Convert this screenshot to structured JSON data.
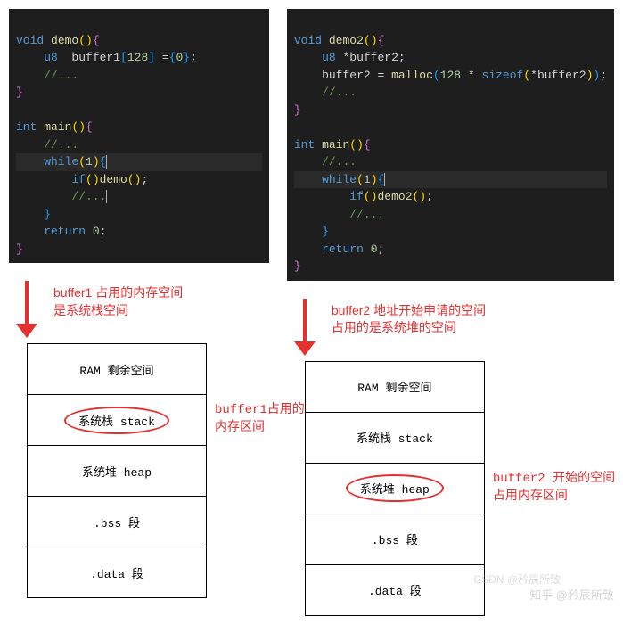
{
  "left": {
    "code": {
      "l1": {
        "kw": "void ",
        "fn": "demo",
        "rest": "(){"
      },
      "l2": {
        "type": "    u8",
        "var": "  buffer1",
        "rest": "[128] ={0};"
      },
      "l3": "    //...",
      "l4": "}",
      "l5": "",
      "l6": {
        "kw": "int ",
        "fn": "main",
        "rest": "(){"
      },
      "l7": "    //...",
      "l8": {
        "kw": "    while",
        "rest": "(1){"
      },
      "l9": {
        "kw": "        if",
        "rest": "()demo();"
      },
      "l10": "        //...",
      "l11": "    }",
      "l12": {
        "kw": "    return ",
        "num": "0",
        "rest": ";"
      },
      "l13": "}"
    },
    "annotation": "buffer1 占用的内存空间\n是系统栈空间",
    "memory": {
      "row1": "RAM 剩余空间",
      "row2": "系统栈 stack",
      "row3": "系统堆 heap",
      "row4": ".bss 段",
      "row5": ".data 段"
    },
    "side_annotation": "buffer1占用的\n内存区间",
    "circled_row": 2
  },
  "right": {
    "code": {
      "l1": {
        "kw": "void ",
        "fn": "demo2",
        "rest": "(){"
      },
      "l2": {
        "type": "    u8 ",
        "var": "*buffer2",
        "rest": ";"
      },
      "l3p1": "    buffer2 = ",
      "l3fn": "malloc",
      "l3p2": "(128 * ",
      "l3kw": "sizeof",
      "l3p3": "(*buffer2));",
      "l4": "    //...",
      "l5": "}",
      "l6": "",
      "l7": {
        "kw": "int ",
        "fn": "main",
        "rest": "(){"
      },
      "l8": "    //...",
      "l9": {
        "kw": "    while",
        "rest": "(1){"
      },
      "l10": {
        "kw": "        if",
        "rest": "()demo2();"
      },
      "l11": "        //...",
      "l12": "    }",
      "l13": {
        "kw": "    return ",
        "num": "0",
        "rest": ";"
      },
      "l14": "}"
    },
    "annotation": "buffer2 地址开始申请的空间\n占用的是系统堆的空间",
    "memory": {
      "row1": "RAM 剩余空间",
      "row2": "系统栈 stack",
      "row3": "系统堆 heap",
      "row4": ".bss 段",
      "row5": ".data 段"
    },
    "side_annotation": "buffer2 开始的空间\n占用内存区间",
    "circled_row": 3
  },
  "watermark1": "知乎 @矜辰所致",
  "watermark2": "CSDN @矜辰所致"
}
